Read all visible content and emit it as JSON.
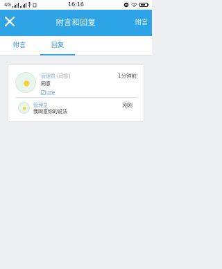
{
  "status_bar": {
    "network": "4G",
    "time": "16:16"
  },
  "header": {
    "title": "附言和回复",
    "action_label": "附言"
  },
  "tabs": [
    {
      "label": "附言",
      "active": false
    },
    {
      "label": "回复",
      "active": true
    }
  ],
  "comment": {
    "author": "管理员",
    "tag": "[同意]",
    "text": "同意",
    "time": "1分钟前",
    "reply_label": "回复"
  },
  "reply": {
    "author": "管理员",
    "text": "我同意你的说法",
    "time": "刚刚"
  },
  "colors": {
    "accent": "#2ea4e6",
    "link": "#7aa9d8",
    "background": "#eeeff3"
  }
}
